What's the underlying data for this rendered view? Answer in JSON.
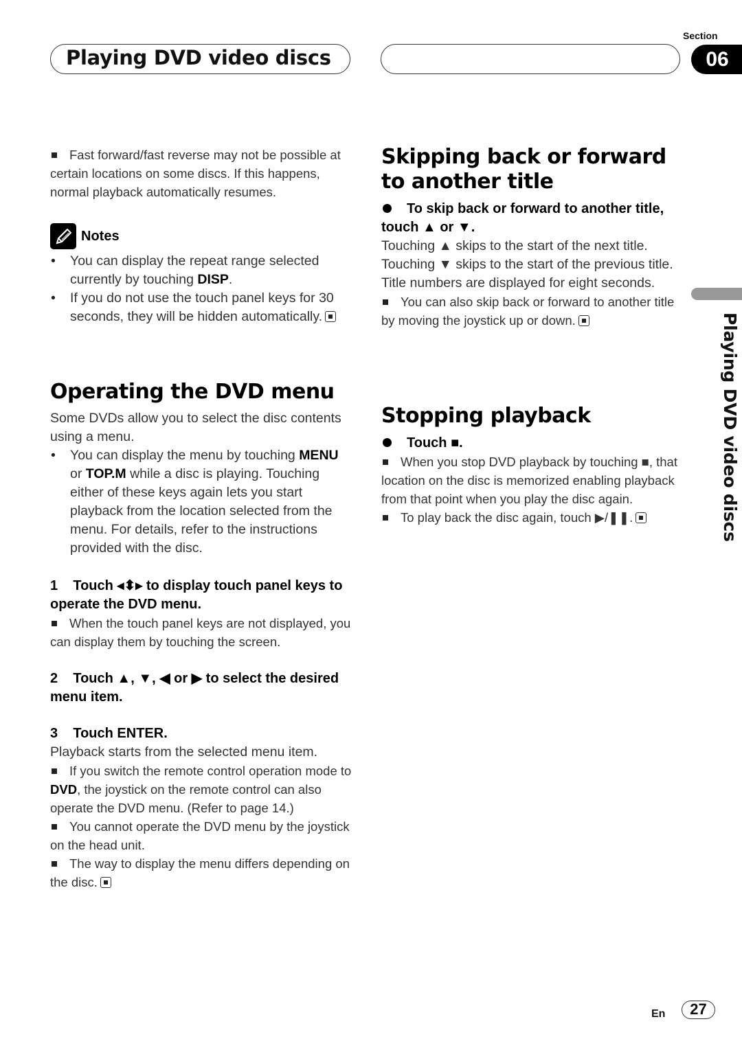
{
  "header": {
    "chapter_title": "Playing DVD video discs",
    "section_label": "Section",
    "section_number": "06",
    "side_tab_text": "Playing DVD video discs"
  },
  "left": {
    "intro_note": "Fast forward/fast reverse may not be possible at certain locations on some discs. If this happens, normal playback automatically resumes.",
    "notes": {
      "label": "Notes",
      "items": [
        {
          "before": "You can display the repeat range selected currently by touching ",
          "bold": "DISP",
          "after": "."
        },
        {
          "before": "If you do not use the touch panel keys for 30 seconds, they will be hidden automatically.",
          "bold": "",
          "after": ""
        }
      ]
    },
    "dvd_menu": {
      "heading": "Operating the DVD menu",
      "intro": "Some DVDs allow you to select the disc contents using a menu.",
      "bullet": {
        "pre": "You can display the menu by touching ",
        "bold1": "MENU",
        "mid": " or ",
        "bold2": "TOP.M",
        "post": " while a disc is playing. Touching either of these keys again lets you start playback from the location selected from the menu. For details, refer to the instructions provided with the disc."
      },
      "steps": [
        {
          "num": "1",
          "text": "Touch ◂⬍▸ to display touch panel keys to operate the DVD menu.",
          "notes": [
            "When the touch panel keys are not displayed, you can display them by touching the screen."
          ]
        },
        {
          "num": "2",
          "text": "Touch ▲, ▼, ◀ or ▶ to select the desired menu item.",
          "notes": []
        },
        {
          "num": "3",
          "text": "Touch ENTER.",
          "body": "Playback starts from the selected menu item.",
          "notes": []
        }
      ],
      "step3_note1": {
        "pre": "If you switch the remote control operation mode to ",
        "bold": "DVD",
        "post": ", the joystick on the remote control can also operate the DVD menu. (Refer to page 14.)"
      },
      "step3_note2": "You cannot operate the DVD menu by the joystick on the head unit.",
      "step3_note3": "The way to display the menu differs depending on the disc."
    }
  },
  "right": {
    "skip": {
      "heading": "Skipping back or forward to another title",
      "instruction": "To skip back or forward to another title, touch ▲ or ▼.",
      "body": [
        "Touching ▲ skips to the start of the next title.",
        "Touching ▼ skips to the start of the previous title.",
        "Title numbers are displayed for eight seconds."
      ],
      "note": "You can also skip back or forward to another title by moving the joystick up or down."
    },
    "stop": {
      "heading": "Stopping playback",
      "instruction": "Touch ■.",
      "note1": "When you stop DVD playback by touching ■, that location on the disc is memorized enabling playback from that point when you play the disc again.",
      "note2": "To play back the disc again, touch ▶/❚❚."
    }
  },
  "footer": {
    "language": "En",
    "page_number": "27"
  }
}
